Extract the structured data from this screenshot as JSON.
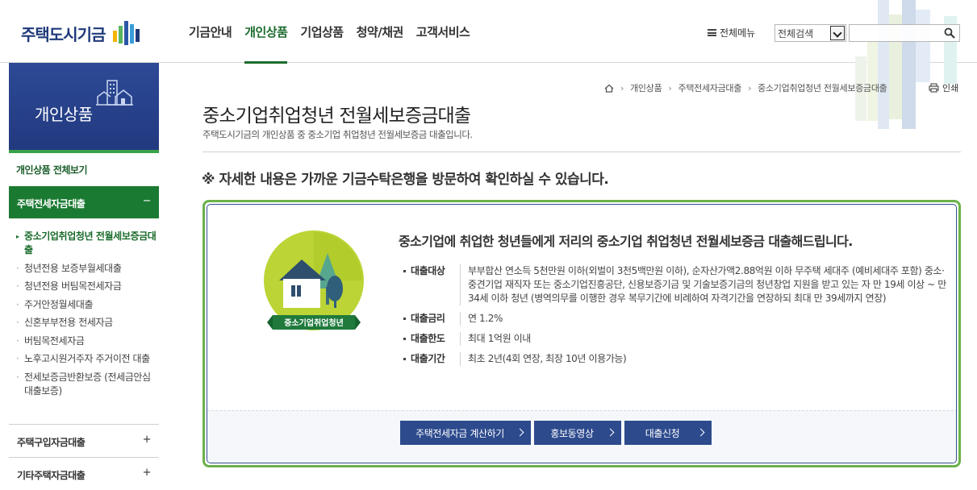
{
  "header": {
    "logo_text": "주택도시기금",
    "nav": [
      "기금안내",
      "개인상품",
      "기업상품",
      "청약/채권",
      "고객서비스"
    ],
    "active_nav": "개인상품",
    "all_menu_label": "전체메뉴",
    "search": {
      "select_value": "전체검색",
      "input_value": ""
    }
  },
  "sidebar": {
    "title": "개인상품",
    "all_view": "개인상품 전체보기",
    "open_section": {
      "label": "주택전세자금대출",
      "toggle": "−"
    },
    "items": [
      "중소기업취업청년 전월세보증금대출",
      "청년전용 보증부월세대출",
      "청년전용 버팀목전세자금",
      "주거안정월세대출",
      "신혼부부전용 전세자금",
      "버팀목전세자금",
      "노후고시원거주자 주거이전 대출",
      "전세보증금반환보증 (전세금안심대출보증)"
    ],
    "current_item": "중소기업취업청년 전월세보증금대출",
    "closed_sections": [
      {
        "label": "주택구입자금대출",
        "toggle": "+"
      },
      {
        "label": "기타주택자금대출",
        "toggle": "+"
      }
    ]
  },
  "breadcrumb": [
    "개인상품",
    "주택전세자금대출",
    "중소기업취업청년 전월세보증금대출"
  ],
  "print_label": "인쇄",
  "page": {
    "title": "중소기업취업청년 전월세보증금대출",
    "description": "주택도시기금의 개인상품 중 중소기업 취업청년 전월세보증금 대출입니다.",
    "notice": "※ 자세한 내용은 가까운 기금수탁은행을 방문하여 확인하실 수 있습니다."
  },
  "product": {
    "badge_label": "중소기업취업청년",
    "headline": "중소기업에 취업한 청년들에게 저리의 중소기업 취업청년 전월세보증금 대출해드립니다.",
    "details": [
      {
        "key": "대출대상",
        "value": "부부합산 연소득 5천만원 이하(외벌이 3천5백만원 이하), 순자산가액2.88억원 이하 무주택 세대주 (예비세대주 포함) 중소·중견기업 재직자 또는 중소기업진흥공단, 신용보증기금 및 기술보증기금의 청년창업 지원을 받고 있는 자 만 19세 이상 ~ 만 34세 이하 청년 (병역의무를 이행한 경우 복무기간에 비례하여 자격기간을 연장하되 최대 만 39세까지 연장)"
      },
      {
        "key": "대출금리",
        "value": "연 1.2%"
      },
      {
        "key": "대출한도",
        "value": "최대 1억원 이내"
      },
      {
        "key": "대출기간",
        "value": "최초 2년(4회 연장, 최장 10년 이용가능)"
      }
    ],
    "buttons": [
      "주택전세자금 계산하기",
      "홍보동영상",
      "대출신청"
    ]
  },
  "colors": {
    "brand_navy": "#2d4a8d",
    "brand_green": "#1b7a32",
    "accent_green": "#6ab24a"
  }
}
